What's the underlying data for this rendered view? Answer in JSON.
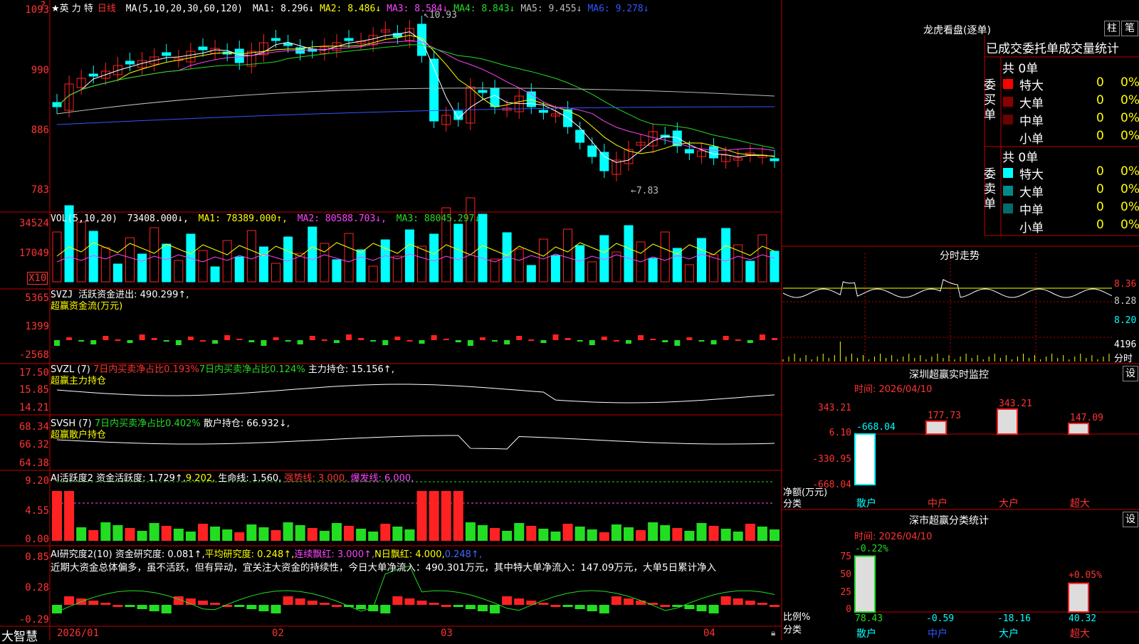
{
  "stock": {
    "name": "★英 力 特",
    "period": "日线"
  },
  "main_panel": {
    "indicator": "MA(5,10,20,30,60,120)",
    "ma": [
      {
        "label": "MA1:",
        "value": "8.296",
        "arrow": "↓",
        "color": "#ffffff"
      },
      {
        "label": "MA2:",
        "value": "8.486",
        "arrow": "↓",
        "color": "#ffff00"
      },
      {
        "label": "MA3:",
        "value": "8.584",
        "arrow": "↓",
        "color": "#ff44ff"
      },
      {
        "label": "MA4:",
        "value": "8.843",
        "arrow": "↓",
        "color": "#22dd22"
      },
      {
        "label": "MA5:",
        "value": "9.455",
        "arrow": "↓",
        "color": "#bbbbbb"
      },
      {
        "label": "MA6:",
        "value": "9.278",
        "arrow": "↓",
        "color": "#3355ff"
      }
    ],
    "y_labels": [
      "1093",
      "990",
      "886",
      "783"
    ],
    "high_mark": "10.93",
    "low_mark": "7.83"
  },
  "vol_panel": {
    "indicator": "VOL(5,10,20)",
    "vol": "73408.000↓,",
    "ma1": "MA1: 78389.000↑,",
    "ma2": "MA2: 80588.703↓,",
    "ma3": "MA3: 88045.297↓",
    "y_labels": [
      "34524",
      "17049"
    ],
    "unit": "X10"
  },
  "svzj_panel": {
    "name": "SVZJ",
    "text": "活跃资金进出: 490.299↑,",
    "subtitle": "超赢资金流(万元)",
    "y_labels": [
      "5365",
      "1399",
      "-2568"
    ]
  },
  "svzl_panel": {
    "name": "SVZL (7)",
    "t1": "7日内买卖净占比0.193%",
    "t2": "7日内买卖净占比0.124%",
    "t3": "主力持仓: 15.156↑,",
    "subtitle": "超赢主力持仓",
    "y_labels": [
      "17.50",
      "15.85",
      "14.21"
    ]
  },
  "svsh_panel": {
    "name": "SVSH (7)",
    "t1": "7日内买卖净占比0.402%",
    "t2": "散户持仓: 66.932↓,",
    "subtitle": "超赢散户持仓",
    "y_labels": [
      "68.34",
      "66.32",
      "64.38"
    ]
  },
  "ai_active_panel": {
    "name": "AI活跃度2",
    "t1": "资金活跃度: 1.729↑,",
    "t2": "9.202,",
    "t3": "生命线: 1.560,",
    "t4": "强势线: 3.000,",
    "t5": "爆发线: 6.000,",
    "y_labels": [
      "9.20",
      "4.55",
      "0.00"
    ]
  },
  "ai_research_panel": {
    "name": "AI研究度2(10)",
    "t1": "资金研究度: 0.081↑,",
    "t2": "平均研究度: 0.248↑,",
    "t3": "连续飘红: 3.000↑,",
    "t4": "N日飘红: 4.000,",
    "t5": "0.248↑,",
    "commentary": "近期大资金总体偏多，虽不活跃，但有异动，宜关注大资金的持续性，今日大单净流入：490.301万元，其中特大单净流入：147.09万元，大单5日累计净入",
    "y_labels": [
      "0.85",
      "0.28",
      "-0.29"
    ]
  },
  "x_axis": {
    "labels": [
      "2026/01",
      "02",
      "03",
      "04"
    ],
    "brand": "大智慧"
  },
  "dragon": {
    "title": "龙虎看盘(逐单)",
    "btn1": "柱",
    "btn2": "笔",
    "tabs_label": "已成交委托单成交量统计",
    "buy": {
      "side": "委买单",
      "total": "共 0单",
      "rows": [
        {
          "name": "特大",
          "count": "0",
          "pct": "0%",
          "color": "#ff0000"
        },
        {
          "name": "大单",
          "count": "0",
          "pct": "0%",
          "color": "#8b0000"
        },
        {
          "name": "中单",
          "count": "0",
          "pct": "0%",
          "color": "#6b0000"
        },
        {
          "name": "小单",
          "count": "0",
          "pct": "0%",
          "color": "#000000"
        }
      ]
    },
    "sell": {
      "side": "委卖单",
      "total": "共 0单",
      "rows": [
        {
          "name": "特大",
          "count": "0",
          "pct": "0%",
          "color": "#00ffff"
        },
        {
          "name": "大单",
          "count": "0",
          "pct": "0%",
          "color": "#008b8b"
        },
        {
          "name": "中单",
          "count": "0",
          "pct": "0%",
          "color": "#006b6b"
        },
        {
          "name": "小单",
          "count": "0",
          "pct": "0%",
          "color": "#000000"
        }
      ]
    }
  },
  "intraday": {
    "title": "分时走势",
    "prices": [
      "8.36",
      "8.28",
      "8.20"
    ],
    "vol": "4196",
    "vol_unit": "分时"
  },
  "sz_monitor": {
    "title": "深圳超赢实时监控",
    "btn": "设",
    "time": "时间: 2026/04/10",
    "y_labels": [
      "343.21",
      "6.10",
      "-330.95",
      "-668.04"
    ],
    "unit1": "净额(万元)",
    "unit2": "分类",
    "chart_data": {
      "type": "bar",
      "categories": [
        "散户",
        "中户",
        "大户",
        "超大"
      ],
      "values": [
        -668.04,
        177.73,
        343.21,
        147.09
      ],
      "value_labels": [
        "-668.04",
        "177.73",
        "343.21",
        "147.09"
      ],
      "ylim": [
        -668.04,
        343.21
      ]
    }
  },
  "sz_class": {
    "title": "深市超赢分类统计",
    "btn": "设",
    "time": "时间: 2026/04/10",
    "y_labels": [
      "75",
      "50",
      "25",
      "0"
    ],
    "unit1": "比例%",
    "unit2": "分类",
    "chart_data": {
      "type": "bar",
      "categories": [
        "散户",
        "中户",
        "大户",
        "超大"
      ],
      "values": [
        78.43,
        -0.59,
        -18.16,
        40.32
      ],
      "bottom_labels": [
        "78.43",
        "-0.59",
        "-18.16",
        "40.32"
      ],
      "top_labels": [
        "-0.22%",
        "",
        "",
        "+0.05%"
      ],
      "ylim": [
        0,
        75
      ]
    }
  }
}
